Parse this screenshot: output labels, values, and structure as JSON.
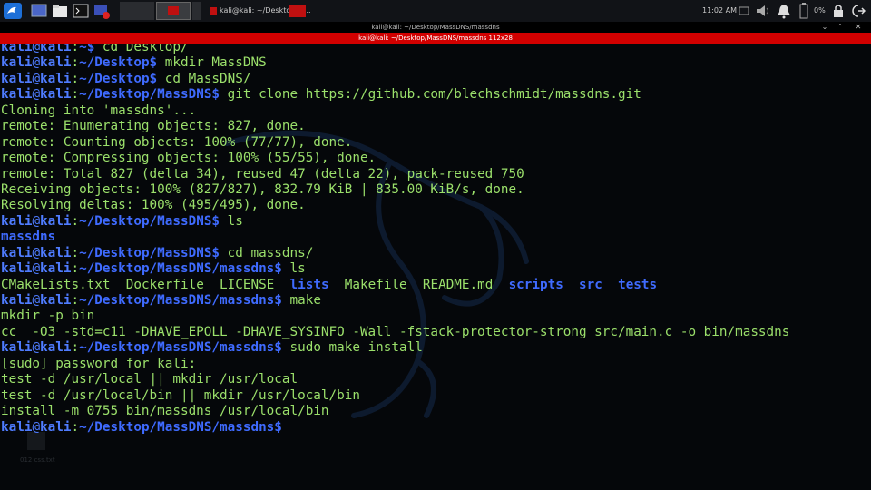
{
  "taskbar": {
    "task_title": "kali@kali: ~/Desktop/M...",
    "clock": "11:02 AM",
    "battery": "0%"
  },
  "window": {
    "title": "kali@kali: ~/Desktop/MassDNS/massdns",
    "term_title": "kali@kali: ~/Desktop/MassDNS/massdns 112x28"
  },
  "desktop": {
    "file_label": "012 css.txt"
  },
  "prompt": {
    "user": "kali",
    "host": "kali",
    "sep_at": "@",
    "colon": ":"
  },
  "terminal": {
    "lines": [
      {
        "type": "prompt",
        "path": "~",
        "cmd": " cd Desktop/"
      },
      {
        "type": "prompt",
        "path": "~/Desktop",
        "cmd": " mkdir MassDNS"
      },
      {
        "type": "prompt",
        "path": "~/Desktop",
        "cmd": " cd MassDNS/"
      },
      {
        "type": "prompt",
        "path": "~/Desktop/MassDNS",
        "cmd": " git clone https://github.com/blechschmidt/massdns.git"
      },
      {
        "type": "out",
        "text": "Cloning into 'massdns'..."
      },
      {
        "type": "out",
        "text": "remote: Enumerating objects: 827, done."
      },
      {
        "type": "out",
        "text": "remote: Counting objects: 100% (77/77), done."
      },
      {
        "type": "out",
        "text": "remote: Compressing objects: 100% (55/55), done."
      },
      {
        "type": "out",
        "text": "remote: Total 827 (delta 34), reused 47 (delta 22), pack-reused 750"
      },
      {
        "type": "out",
        "text": "Receiving objects: 100% (827/827), 832.79 KiB | 835.00 KiB/s, done."
      },
      {
        "type": "out",
        "text": "Resolving deltas: 100% (495/495), done."
      },
      {
        "type": "prompt",
        "path": "~/Desktop/MassDNS",
        "cmd": " ls"
      },
      {
        "type": "ls",
        "items": [
          {
            "name": "massdns",
            "dir": true
          }
        ]
      },
      {
        "type": "prompt",
        "path": "~/Desktop/MassDNS",
        "cmd": " cd massdns/"
      },
      {
        "type": "prompt",
        "path": "~/Desktop/MassDNS/massdns",
        "cmd": " ls"
      },
      {
        "type": "ls",
        "items": [
          {
            "name": "CMakeLists.txt",
            "dir": false
          },
          {
            "name": "Dockerfile",
            "dir": false
          },
          {
            "name": "LICENSE",
            "dir": false
          },
          {
            "name": "lists",
            "dir": true
          },
          {
            "name": "Makefile",
            "dir": false
          },
          {
            "name": "README.md",
            "dir": false
          },
          {
            "name": "scripts",
            "dir": true
          },
          {
            "name": "src",
            "dir": true
          },
          {
            "name": "tests",
            "dir": true
          }
        ]
      },
      {
        "type": "prompt",
        "path": "~/Desktop/MassDNS/massdns",
        "cmd": " make"
      },
      {
        "type": "out",
        "text": "mkdir -p bin"
      },
      {
        "type": "out",
        "text": "cc  -O3 -std=c11 -DHAVE_EPOLL -DHAVE_SYSINFO -Wall -fstack-protector-strong src/main.c -o bin/massdns"
      },
      {
        "type": "prompt",
        "path": "~/Desktop/MassDNS/massdns",
        "cmd": " sudo make install"
      },
      {
        "type": "out",
        "text": "[sudo] password for kali:"
      },
      {
        "type": "out",
        "text": "test -d /usr/local || mkdir /usr/local"
      },
      {
        "type": "out",
        "text": "test -d /usr/local/bin || mkdir /usr/local/bin"
      },
      {
        "type": "out",
        "text": "install -m 0755 bin/massdns /usr/local/bin"
      },
      {
        "type": "prompt",
        "path": "~/Desktop/MassDNS/massdns",
        "cmd": ""
      }
    ]
  },
  "colors": {
    "accent_red": "#d10000",
    "prompt_blue": "#4f7cff",
    "text_green": "#9be06b",
    "dir_blue": "#3f6bff"
  }
}
